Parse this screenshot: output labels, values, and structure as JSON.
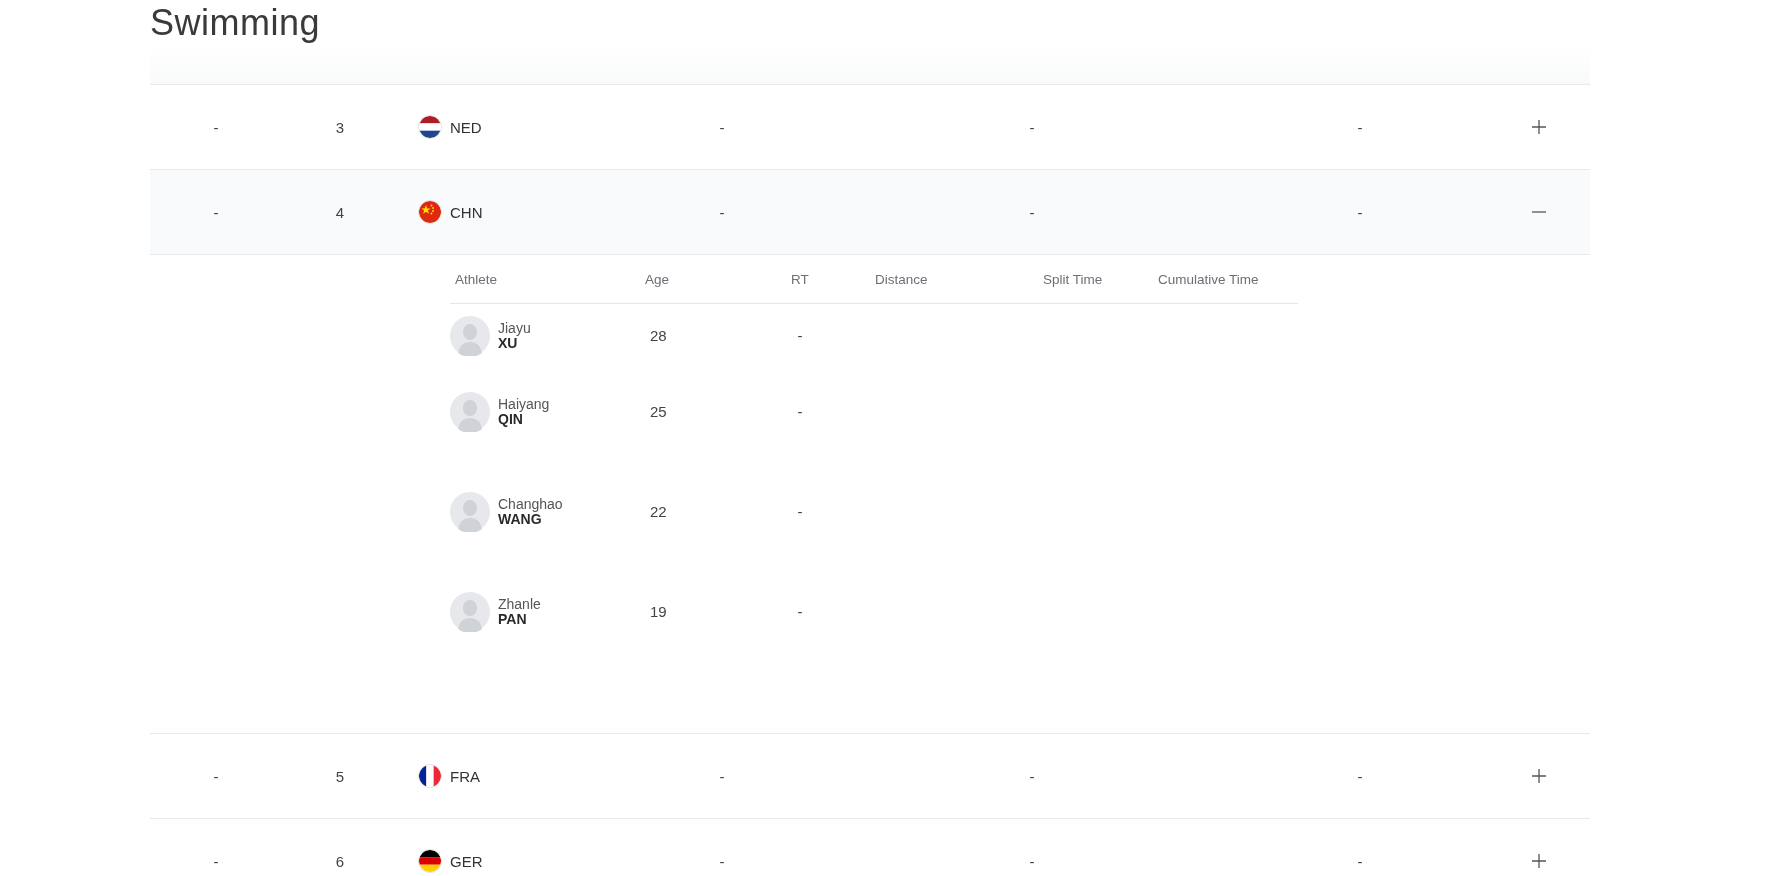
{
  "title": "Swimming",
  "rows": [
    {
      "position": "-",
      "rank": "3",
      "country": "NED",
      "kind": "netherlands",
      "cells": [
        "-",
        "-",
        "-"
      ],
      "expanded": false
    },
    {
      "position": "-",
      "rank": "4",
      "country": "CHN",
      "kind": "china",
      "cells": [
        "-",
        "-",
        "-"
      ],
      "expanded": true,
      "athlete_table": {
        "columns": [
          "Athlete",
          "Age",
          "RT",
          "Distance",
          "Split Time",
          "Cumulative Time"
        ],
        "athletes": [
          {
            "first_name": "Jiayu",
            "last_name": "XU",
            "age": "28",
            "rt": "-"
          },
          {
            "first_name": "Haiyang",
            "last_name": "QIN",
            "age": "25",
            "rt": "-"
          },
          {
            "first_name": "Changhao",
            "last_name": "WANG",
            "age": "22",
            "rt": "-"
          },
          {
            "first_name": "Zhanle",
            "last_name": "PAN",
            "age": "19",
            "rt": "-"
          }
        ]
      }
    },
    {
      "position": "-",
      "rank": "5",
      "country": "FRA",
      "kind": "france",
      "cells": [
        "-",
        "-",
        "-"
      ],
      "expanded": false
    },
    {
      "position": "-",
      "rank": "6",
      "country": "GER",
      "kind": "germany",
      "cells": [
        "-",
        "-",
        "-"
      ],
      "expanded": false
    }
  ]
}
